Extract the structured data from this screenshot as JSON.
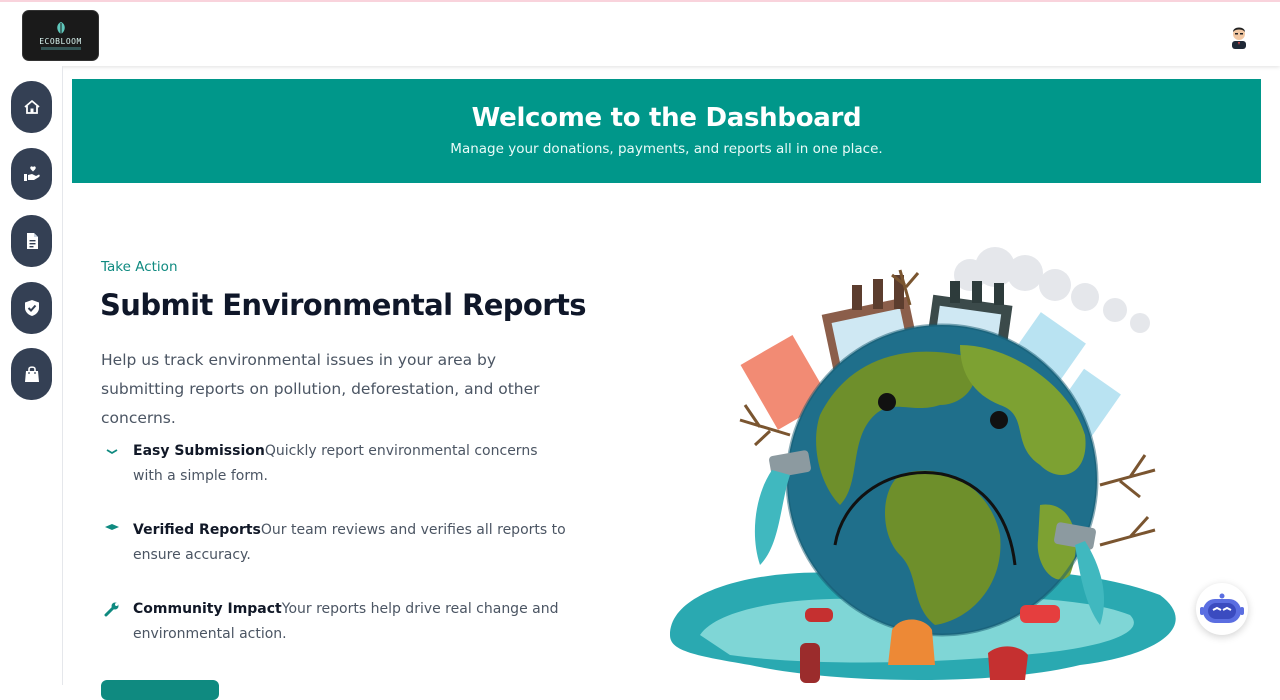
{
  "brand": {
    "logo_text": "ECOBLOOM"
  },
  "banner": {
    "title": "Welcome to the Dashboard",
    "subtitle": "Manage your donations, payments, and reports all in one place."
  },
  "sidebar": {
    "items": [
      {
        "icon": "home-icon"
      },
      {
        "icon": "donate-hand-heart-icon"
      },
      {
        "icon": "report-document-icon"
      },
      {
        "icon": "verified-shield-icon"
      },
      {
        "icon": "shopping-bag-icon"
      }
    ]
  },
  "section": {
    "eyebrow": "Take Action",
    "title": "Submit Environmental Reports",
    "lead": "Help us track environmental issues in your area by submitting reports on pollution, deforestation, and other concerns."
  },
  "features": [
    {
      "icon": "chevron-down-icon",
      "title": "Easy Submission",
      "text": "Quickly report environmental concerns with a simple form."
    },
    {
      "icon": "diamond-icon",
      "title": "Verified Reports",
      "text": "Our team reviews and verifies all reports to ensure accuracy."
    },
    {
      "icon": "wrench-icon",
      "title": "Community Impact",
      "text": "Your reports help drive real change and environmental action."
    }
  ],
  "colors": {
    "accent": "#00978a",
    "sidebar_button": "#344054",
    "heading": "#0f1729"
  }
}
